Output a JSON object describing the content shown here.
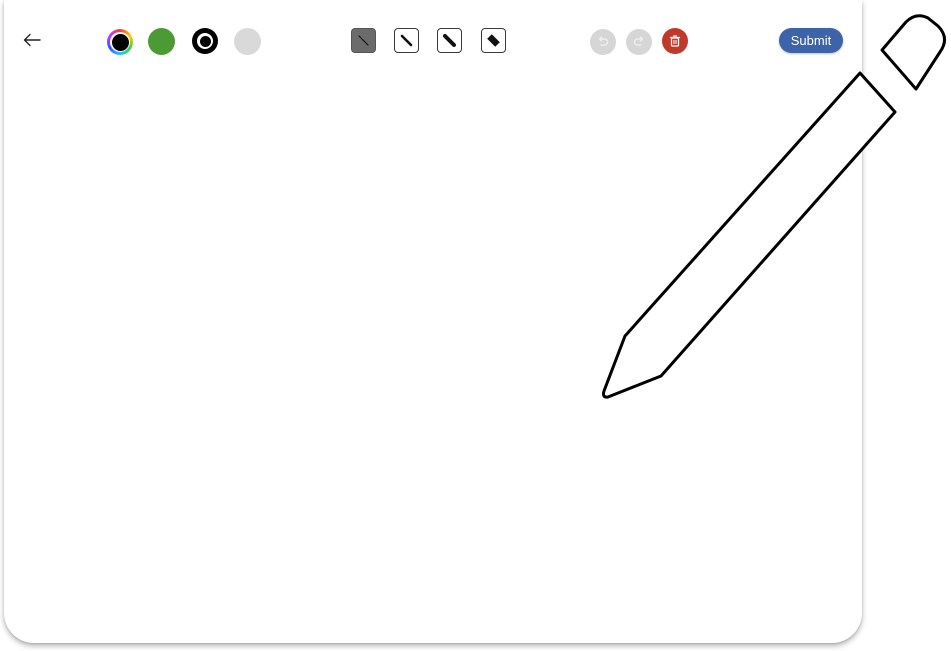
{
  "toolbar": {
    "back_icon": "arrow-left-icon",
    "colors": [
      {
        "name": "custom-color",
        "color": "#000000",
        "icon": "rainbow-ring"
      },
      {
        "name": "green",
        "color": "#4b9a33"
      },
      {
        "name": "black",
        "color": "#000000",
        "selected": true
      },
      {
        "name": "light-gray",
        "color": "#d9d9d9"
      }
    ],
    "brush_sizes": [
      "thin",
      "medium",
      "thick",
      "extra-thick"
    ],
    "selected_brush": "thin",
    "undo_icon": "undo-icon",
    "redo_icon": "redo-icon",
    "delete_icon": "trash-icon",
    "submit_label": "Submit"
  },
  "canvas": {
    "drawing": "pencil-outline"
  },
  "colors": {
    "accent": "#3d63a8",
    "danger": "#c0392b",
    "disabled": "#d6d6d6"
  }
}
